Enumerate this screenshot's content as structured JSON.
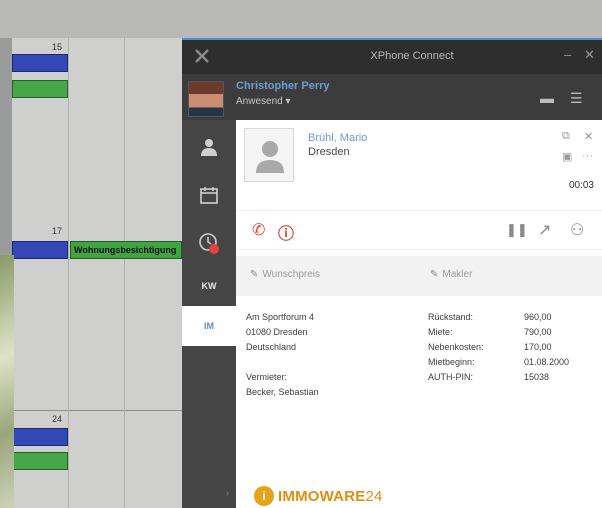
{
  "calendar": {
    "day_numbers": [
      "15",
      "17",
      "24"
    ],
    "event_label": "Wohnungsbesichtigung"
  },
  "window": {
    "title": "XPhone Connect",
    "minimize_icon": "minus-icon",
    "close_icon": "close-icon"
  },
  "user": {
    "name": "Christopher Perry",
    "status": "Anwesend ▾"
  },
  "sidebar": {
    "items": [
      {
        "name": "contacts",
        "icon": "person-icon"
      },
      {
        "name": "calendar",
        "icon": "calendar-icon"
      },
      {
        "name": "history",
        "icon": "clock-icon"
      },
      {
        "name": "kw",
        "label": "KW"
      },
      {
        "name": "im",
        "label": "IM"
      }
    ]
  },
  "contact": {
    "name": "Brühl, Mario",
    "city": "Dresden",
    "duration": "00:03"
  },
  "fields": {
    "left": "Wunschpreis",
    "right": "Makler"
  },
  "address": {
    "street": "Am Sportforum 4",
    "zip_city": "01080 Dresden",
    "country": "Deutschland",
    "landlord_label": "Vermieter:",
    "landlord": "Becker, Sebastian"
  },
  "financials": {
    "rows": [
      {
        "label": "Rückstand:",
        "value": "960,00"
      },
      {
        "label": "Miete:",
        "value": "790,00"
      },
      {
        "label": "Nebenkosten:",
        "value": "170,00"
      },
      {
        "label": "Mietbeginn:",
        "value": "01.08.2000"
      },
      {
        "label": "AUTH-PIN:",
        "value": "15038"
      }
    ]
  },
  "brand": {
    "name": "IMMOWARE",
    "suffix": "24",
    "color": "#e38c10"
  },
  "colors": {
    "accent": "#4a8fcf",
    "hangup": "#e0443a",
    "event_green": "#40a443",
    "event_blue": "#3347b5"
  }
}
